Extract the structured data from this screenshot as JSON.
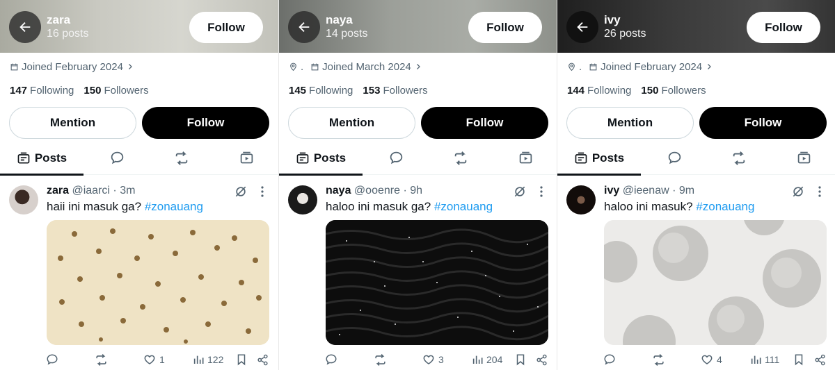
{
  "colors": {
    "text": "#0f1419",
    "secondary": "#536471",
    "link": "#1d9bf0",
    "primary_button": "#000000"
  },
  "icons": [
    "back-arrow-icon",
    "location-icon",
    "calendar-icon",
    "chevron-right-icon",
    "posts-icon",
    "replies-icon",
    "reposts-icon",
    "media-icon",
    "grok-icon",
    "more-icon",
    "reply-icon",
    "repost-icon",
    "like-icon",
    "views-icon",
    "bookmark-icon",
    "share-icon"
  ],
  "profiles": [
    {
      "header": {
        "name": "zara",
        "posts": "16 posts",
        "follow": "Follow"
      },
      "meta": {
        "location": "",
        "joined": "Joined February 2024"
      },
      "counts": {
        "following": "147",
        "following_label": "Following",
        "followers": "150",
        "followers_label": "Followers"
      },
      "buttons": {
        "mention": "Mention",
        "follow": "Follow"
      },
      "tabs": {
        "posts": "Posts"
      },
      "post": {
        "name": "zara",
        "handle": "@iaarci",
        "time": "· 3m",
        "text": "haii ini masuk ga? ",
        "hashtag": "#zonauang",
        "stats": {
          "replies": "",
          "reposts": "",
          "likes": "1",
          "views": "122"
        }
      }
    },
    {
      "header": {
        "name": "naya",
        "posts": "14 posts",
        "follow": "Follow"
      },
      "meta": {
        "location": ".",
        "joined": "Joined March 2024"
      },
      "counts": {
        "following": "145",
        "following_label": "Following",
        "followers": "153",
        "followers_label": "Followers"
      },
      "buttons": {
        "mention": "Mention",
        "follow": "Follow"
      },
      "tabs": {
        "posts": "Posts"
      },
      "post": {
        "name": "naya",
        "handle": "@ooenre",
        "time": "· 9h",
        "text": "haloo ini masuk ga? ",
        "hashtag": "#zonauang",
        "stats": {
          "replies": "",
          "reposts": "",
          "likes": "3",
          "views": "204"
        }
      }
    },
    {
      "header": {
        "name": "ivy",
        "posts": "26 posts",
        "follow": "Follow"
      },
      "meta": {
        "location": ".",
        "joined": "Joined February 2024"
      },
      "counts": {
        "following": "144",
        "following_label": "Following",
        "followers": "150",
        "followers_label": "Followers"
      },
      "buttons": {
        "mention": "Mention",
        "follow": "Follow"
      },
      "tabs": {
        "posts": "Posts"
      },
      "post": {
        "name": "ivy",
        "handle": "@ieenaw",
        "time": "· 9m",
        "text": "haloo ini masuk? ",
        "hashtag": "#zonauang",
        "stats": {
          "replies": "",
          "reposts": "",
          "likes": "4",
          "views": "111"
        }
      }
    }
  ]
}
